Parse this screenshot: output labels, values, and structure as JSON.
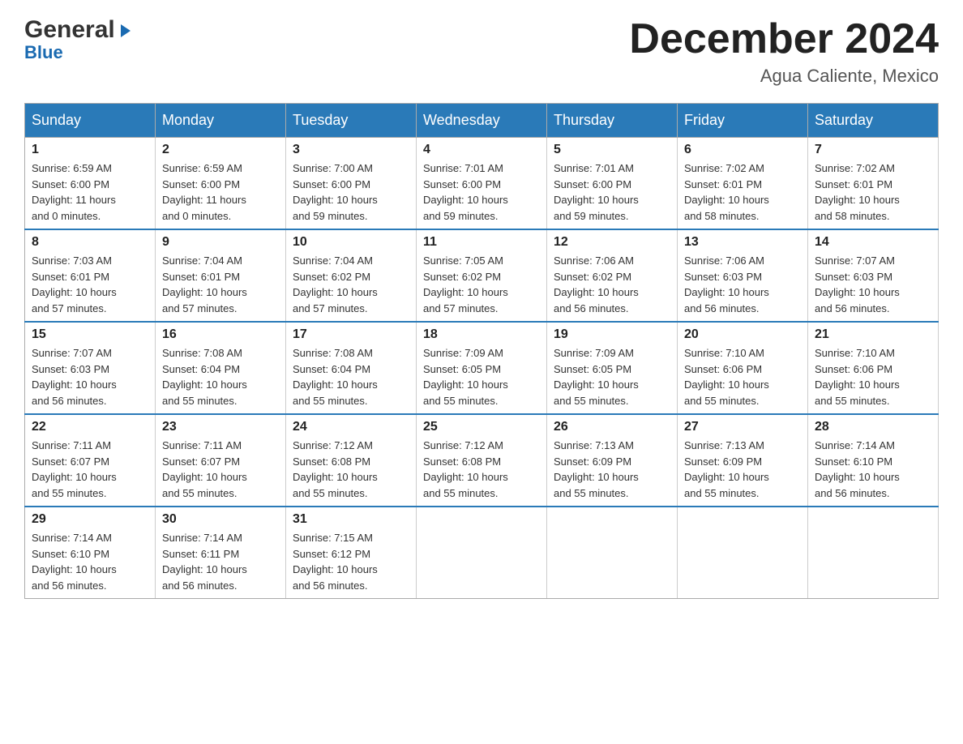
{
  "header": {
    "logo_line1": "General",
    "logo_line2": "Blue",
    "month_title": "December 2024",
    "subtitle": "Agua Caliente, Mexico"
  },
  "days_of_week": [
    "Sunday",
    "Monday",
    "Tuesday",
    "Wednesday",
    "Thursday",
    "Friday",
    "Saturday"
  ],
  "weeks": [
    [
      {
        "day": "1",
        "sunrise": "6:59 AM",
        "sunset": "6:00 PM",
        "daylight": "11 hours and 0 minutes."
      },
      {
        "day": "2",
        "sunrise": "6:59 AM",
        "sunset": "6:00 PM",
        "daylight": "11 hours and 0 minutes."
      },
      {
        "day": "3",
        "sunrise": "7:00 AM",
        "sunset": "6:00 PM",
        "daylight": "10 hours and 59 minutes."
      },
      {
        "day": "4",
        "sunrise": "7:01 AM",
        "sunset": "6:00 PM",
        "daylight": "10 hours and 59 minutes."
      },
      {
        "day": "5",
        "sunrise": "7:01 AM",
        "sunset": "6:00 PM",
        "daylight": "10 hours and 59 minutes."
      },
      {
        "day": "6",
        "sunrise": "7:02 AM",
        "sunset": "6:01 PM",
        "daylight": "10 hours and 58 minutes."
      },
      {
        "day": "7",
        "sunrise": "7:02 AM",
        "sunset": "6:01 PM",
        "daylight": "10 hours and 58 minutes."
      }
    ],
    [
      {
        "day": "8",
        "sunrise": "7:03 AM",
        "sunset": "6:01 PM",
        "daylight": "10 hours and 57 minutes."
      },
      {
        "day": "9",
        "sunrise": "7:04 AM",
        "sunset": "6:01 PM",
        "daylight": "10 hours and 57 minutes."
      },
      {
        "day": "10",
        "sunrise": "7:04 AM",
        "sunset": "6:02 PM",
        "daylight": "10 hours and 57 minutes."
      },
      {
        "day": "11",
        "sunrise": "7:05 AM",
        "sunset": "6:02 PM",
        "daylight": "10 hours and 57 minutes."
      },
      {
        "day": "12",
        "sunrise": "7:06 AM",
        "sunset": "6:02 PM",
        "daylight": "10 hours and 56 minutes."
      },
      {
        "day": "13",
        "sunrise": "7:06 AM",
        "sunset": "6:03 PM",
        "daylight": "10 hours and 56 minutes."
      },
      {
        "day": "14",
        "sunrise": "7:07 AM",
        "sunset": "6:03 PM",
        "daylight": "10 hours and 56 minutes."
      }
    ],
    [
      {
        "day": "15",
        "sunrise": "7:07 AM",
        "sunset": "6:03 PM",
        "daylight": "10 hours and 56 minutes."
      },
      {
        "day": "16",
        "sunrise": "7:08 AM",
        "sunset": "6:04 PM",
        "daylight": "10 hours and 55 minutes."
      },
      {
        "day": "17",
        "sunrise": "7:08 AM",
        "sunset": "6:04 PM",
        "daylight": "10 hours and 55 minutes."
      },
      {
        "day": "18",
        "sunrise": "7:09 AM",
        "sunset": "6:05 PM",
        "daylight": "10 hours and 55 minutes."
      },
      {
        "day": "19",
        "sunrise": "7:09 AM",
        "sunset": "6:05 PM",
        "daylight": "10 hours and 55 minutes."
      },
      {
        "day": "20",
        "sunrise": "7:10 AM",
        "sunset": "6:06 PM",
        "daylight": "10 hours and 55 minutes."
      },
      {
        "day": "21",
        "sunrise": "7:10 AM",
        "sunset": "6:06 PM",
        "daylight": "10 hours and 55 minutes."
      }
    ],
    [
      {
        "day": "22",
        "sunrise": "7:11 AM",
        "sunset": "6:07 PM",
        "daylight": "10 hours and 55 minutes."
      },
      {
        "day": "23",
        "sunrise": "7:11 AM",
        "sunset": "6:07 PM",
        "daylight": "10 hours and 55 minutes."
      },
      {
        "day": "24",
        "sunrise": "7:12 AM",
        "sunset": "6:08 PM",
        "daylight": "10 hours and 55 minutes."
      },
      {
        "day": "25",
        "sunrise": "7:12 AM",
        "sunset": "6:08 PM",
        "daylight": "10 hours and 55 minutes."
      },
      {
        "day": "26",
        "sunrise": "7:13 AM",
        "sunset": "6:09 PM",
        "daylight": "10 hours and 55 minutes."
      },
      {
        "day": "27",
        "sunrise": "7:13 AM",
        "sunset": "6:09 PM",
        "daylight": "10 hours and 55 minutes."
      },
      {
        "day": "28",
        "sunrise": "7:14 AM",
        "sunset": "6:10 PM",
        "daylight": "10 hours and 56 minutes."
      }
    ],
    [
      {
        "day": "29",
        "sunrise": "7:14 AM",
        "sunset": "6:10 PM",
        "daylight": "10 hours and 56 minutes."
      },
      {
        "day": "30",
        "sunrise": "7:14 AM",
        "sunset": "6:11 PM",
        "daylight": "10 hours and 56 minutes."
      },
      {
        "day": "31",
        "sunrise": "7:15 AM",
        "sunset": "6:12 PM",
        "daylight": "10 hours and 56 minutes."
      },
      null,
      null,
      null,
      null
    ]
  ],
  "labels": {
    "sunrise": "Sunrise:",
    "sunset": "Sunset:",
    "daylight": "Daylight:"
  }
}
